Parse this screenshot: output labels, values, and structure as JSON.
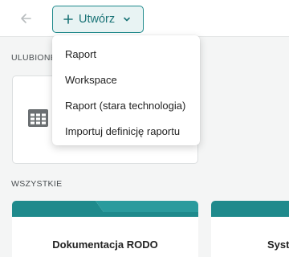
{
  "header": {
    "back_icon": "arrow-left-icon",
    "create_button": {
      "label": "Utwórz",
      "icon": "plus-icon",
      "caret_icon": "chevron-down-icon"
    }
  },
  "sections": {
    "favorites_label": "ULUBIONE",
    "all_label": "WSZYSTKIE"
  },
  "favorites": [
    {
      "icon": "table-grid-icon"
    }
  ],
  "all_reports": [
    {
      "title": "Dokumentacja RODO"
    },
    {
      "title": "Syste"
    }
  ],
  "dropdown": {
    "items": [
      {
        "label": "Raport"
      },
      {
        "label": "Workspace"
      },
      {
        "label": "Raport (stara technologia)"
      },
      {
        "label": "Importuj definicję raportu"
      }
    ]
  },
  "colors": {
    "accent": "#1f8a8c",
    "accent_text": "#1b7477",
    "accent_bg": "#e8f3f3",
    "background": "#f4f5f5"
  }
}
